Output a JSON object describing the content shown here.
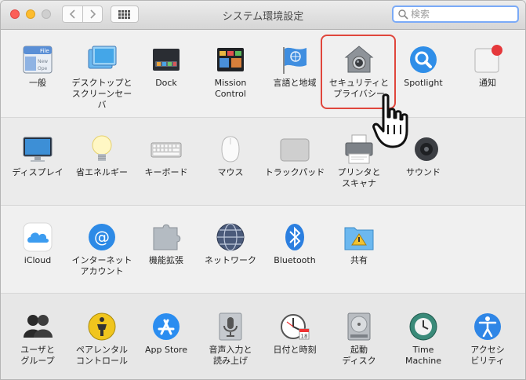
{
  "window": {
    "title": "システム環境設定"
  },
  "search": {
    "placeholder": "検索",
    "value": ""
  },
  "toolbar": {
    "back_icon": "chevron-left-icon",
    "forward_icon": "chevron-right-icon",
    "show_all_icon": "grid-icon"
  },
  "sections": [
    {
      "panes": [
        {
          "label": "一般",
          "icon": "general-icon"
        },
        {
          "label": "デスクトップと\nスクリーンセーバ",
          "icon": "desktop-screensaver-icon"
        },
        {
          "label": "Dock",
          "icon": "dock-icon"
        },
        {
          "label": "Mission\nControl",
          "icon": "mission-control-icon"
        },
        {
          "label": "言語と地域",
          "icon": "language-region-icon"
        },
        {
          "label": "セキュリティと\nプライバシー",
          "icon": "security-privacy-icon"
        },
        {
          "label": "Spotlight",
          "icon": "spotlight-icon"
        },
        {
          "label": "通知",
          "icon": "notifications-icon"
        }
      ]
    },
    {
      "panes": [
        {
          "label": "ディスプレイ",
          "icon": "displays-icon"
        },
        {
          "label": "省エネルギー",
          "icon": "energy-saver-icon"
        },
        {
          "label": "キーボード",
          "icon": "keyboard-icon"
        },
        {
          "label": "マウス",
          "icon": "mouse-icon"
        },
        {
          "label": "トラックパッド",
          "icon": "trackpad-icon"
        },
        {
          "label": "プリンタと\nスキャナ",
          "icon": "printers-scanners-icon"
        },
        {
          "label": "サウンド",
          "icon": "sound-icon"
        }
      ]
    },
    {
      "panes": [
        {
          "label": "iCloud",
          "icon": "icloud-icon"
        },
        {
          "label": "インターネット\nアカウント",
          "icon": "internet-accounts-icon"
        },
        {
          "label": "機能拡張",
          "icon": "extensions-icon"
        },
        {
          "label": "ネットワーク",
          "icon": "network-icon"
        },
        {
          "label": "Bluetooth",
          "icon": "bluetooth-icon"
        },
        {
          "label": "共有",
          "icon": "sharing-icon"
        }
      ]
    },
    {
      "panes": [
        {
          "label": "ユーザと\nグループ",
          "icon": "users-groups-icon"
        },
        {
          "label": "ペアレンタル\nコントロール",
          "icon": "parental-controls-icon"
        },
        {
          "label": "App Store",
          "icon": "app-store-icon"
        },
        {
          "label": "音声入力と\n読み上げ",
          "icon": "dictation-speech-icon"
        },
        {
          "label": "日付と時刻",
          "icon": "date-time-icon"
        },
        {
          "label": "起動\nディスク",
          "icon": "startup-disk-icon"
        },
        {
          "label": "Time\nMachine",
          "icon": "time-machine-icon"
        },
        {
          "label": "アクセシ\nビリティ",
          "icon": "accessibility-icon"
        }
      ]
    }
  ],
  "highlight": {
    "pane": "security-privacy",
    "color": "#e0463c"
  },
  "pointer": {
    "icon": "hand-pointer-icon"
  },
  "colors": {
    "accent": "#1f8ff0",
    "search_focus": "#7aaaf7"
  }
}
